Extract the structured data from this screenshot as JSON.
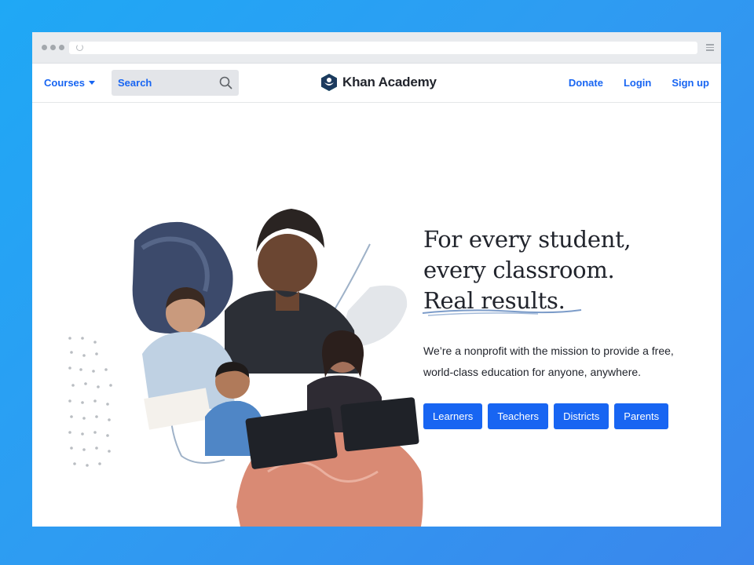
{
  "nav": {
    "courses_label": "Courses",
    "search_placeholder": "Search",
    "logo_text": "Khan Academy",
    "donate": "Donate",
    "login": "Login",
    "signup": "Sign up"
  },
  "hero": {
    "headline_line1": "For every student,",
    "headline_line2": "every classroom.",
    "headline_line3": "Real results.",
    "subtext_line1": "We’re a nonprofit with the mission to provide a free,",
    "subtext_line2": "world-class education for anyone, anywhere.",
    "buttons": [
      "Learners",
      "Teachers",
      "Districts",
      "Parents"
    ]
  },
  "colors": {
    "accent": "#1865f2",
    "background_gradient_start": "#1fa8f5",
    "background_gradient_end": "#3a86ec",
    "text": "#21242c"
  },
  "icons": {
    "search": "search-icon",
    "logo": "khan-academy-hexagon-icon",
    "courses_dropdown": "chevron-down-icon"
  }
}
